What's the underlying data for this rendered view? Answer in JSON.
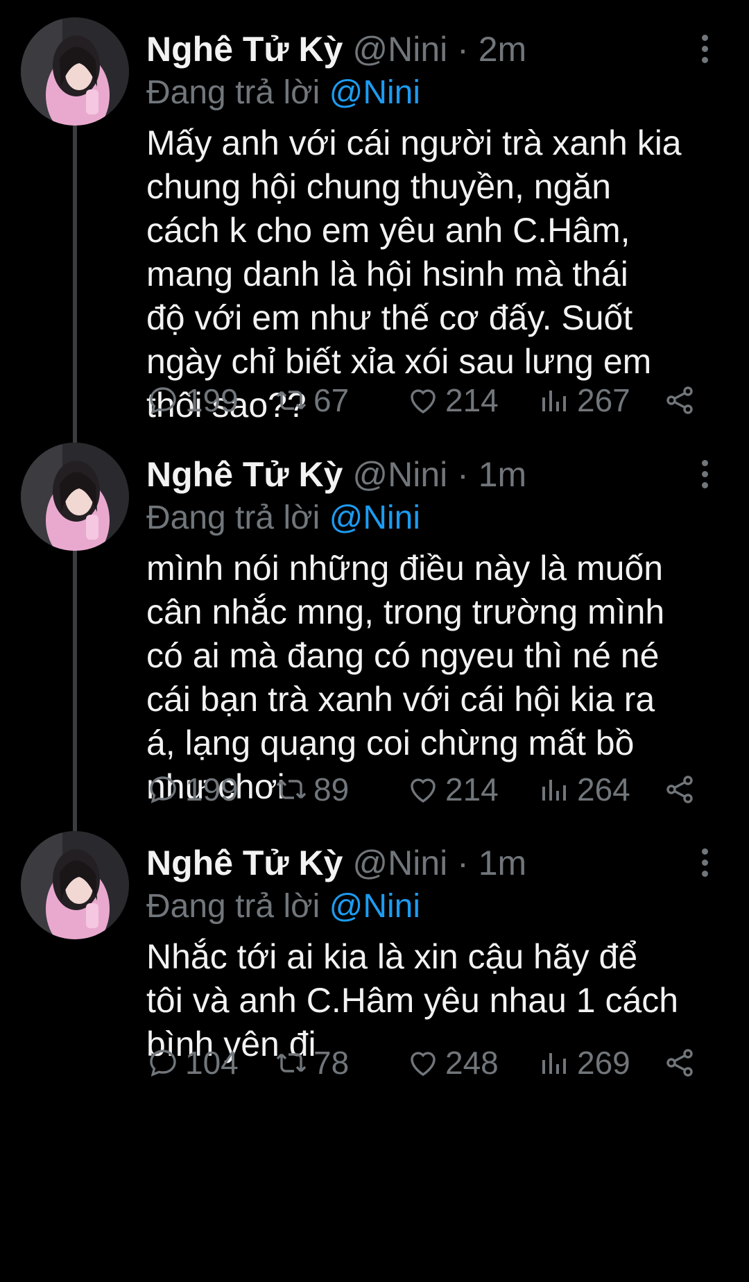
{
  "tweets": [
    {
      "name": "Nghê Tử Kỳ",
      "handle": "@Nini",
      "separator": "·",
      "time": "2m",
      "reply_label": "Đang trả lời",
      "reply_to": "@Nini",
      "text": "Mấy anh với cái người trà xanh kia\nchung hội chung thuyền, ngăn\ncách k cho em yêu anh C.Hâm,\nmang danh là hội hsinh mà thái\nđộ với em như thế cơ đấy. Suốt\nngày chỉ biết xỉa xói sau lưng em\nthôi sao??",
      "replies": "199",
      "retweets": "67",
      "likes": "214",
      "views": "267"
    },
    {
      "name": "Nghê Tử Kỳ",
      "handle": "@Nini",
      "separator": "·",
      "time": "1m",
      "reply_label": "Đang trả lời",
      "reply_to": "@Nini",
      "text": "mình nói những điều này là muốn\ncân nhắc mng, trong trường mình\ncó ai mà đang có ngyeu thì né né\ncái bạn trà xanh với cái hội kia ra\ná, lạng quạng coi chừng mất bồ\nnhư chơi",
      "replies": "199",
      "retweets": "89",
      "likes": "214",
      "views": "264"
    },
    {
      "name": "Nghê Tử Kỳ",
      "handle": "@Nini",
      "separator": "·",
      "time": "1m",
      "reply_label": "Đang trả lời",
      "reply_to": "@Nini",
      "text": "Nhắc tới ai kia là xin cậu hãy để\ntôi và anh C.Hâm yêu nhau 1 cách\nbình yên đi",
      "replies": "104",
      "retweets": "78",
      "likes": "248",
      "views": "269"
    }
  ],
  "colors": {
    "background": "#000000",
    "text": "#f2f2f2",
    "muted": "#71767b",
    "accent": "#1d9bf0",
    "thread_line": "#3a3d40"
  },
  "icons": {
    "reply": "comment-bubble-icon",
    "retweet": "retweet-icon",
    "like": "heart-icon",
    "views": "bar-chart-icon",
    "share": "share-icon",
    "more": "vertical-dots-icon"
  }
}
